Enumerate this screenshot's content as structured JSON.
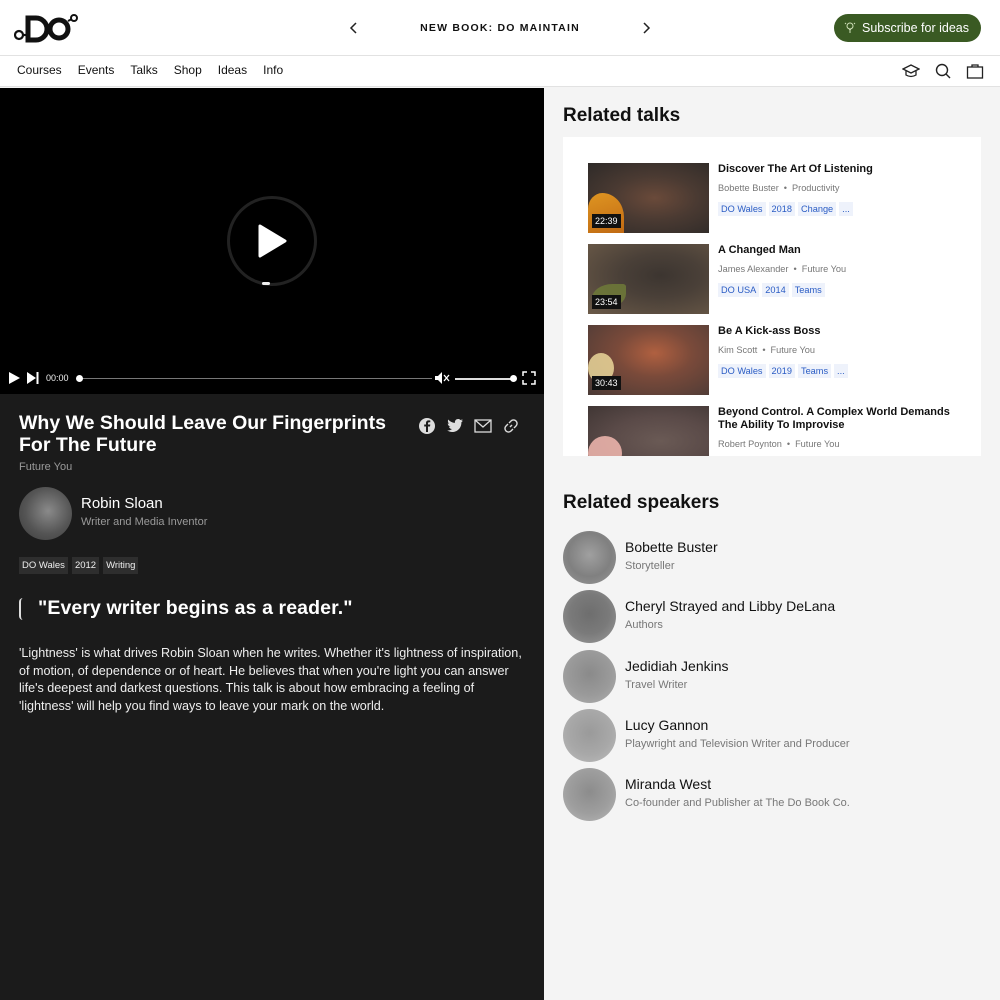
{
  "header": {
    "promo_text": "NEW BOOK: DO MAINTAIN",
    "subscribe_label": "Subscribe for ideas"
  },
  "nav": {
    "items": [
      "Courses",
      "Events",
      "Talks",
      "Shop",
      "Ideas",
      "Info"
    ]
  },
  "player": {
    "time": "00:00",
    "progress": 0,
    "volume": 1
  },
  "talk": {
    "title": "Why We Should Leave Our Fingerprints For The Future",
    "category": "Future You",
    "speaker_name": "Robin Sloan",
    "speaker_role": "Writer and Media Inventor",
    "tags": [
      "DO Wales",
      "2012",
      "Writing"
    ],
    "quote": "\"Every writer begins as a reader.\"",
    "description": "'Lightness' is what drives Robin Sloan when he writes. Whether it's lightness of inspiration, of motion, of dependence or of heart. He believes that when you're light you can answer life's deepest and darkest questions. This talk is about how embracing a feeling of 'lightness' will help you find ways to leave your mark on the world."
  },
  "related_talks": {
    "title": "Related talks",
    "items": [
      {
        "title": "Discover The Art Of Listening",
        "speaker": "Bobette Buster",
        "category": "Productivity",
        "duration": "22:39",
        "tags": [
          "DO Wales",
          "2018",
          "Change",
          "..."
        ]
      },
      {
        "title": "A Changed Man",
        "speaker": "James Alexander",
        "category": "Future You",
        "duration": "23:54",
        "tags": [
          "DO USA",
          "2014",
          "Teams"
        ]
      },
      {
        "title": "Be A Kick-ass Boss",
        "speaker": "Kim Scott",
        "category": "Future You",
        "duration": "30:43",
        "tags": [
          "DO Wales",
          "2019",
          "Teams",
          "..."
        ]
      },
      {
        "title": "Beyond Control. A Complex World Demands The Ability To Improvise",
        "speaker": "Robert Poynton",
        "category": "Future You",
        "duration": "",
        "tags": []
      }
    ]
  },
  "related_speakers": {
    "title": "Related speakers",
    "items": [
      {
        "name": "Bobette Buster",
        "role": "Storyteller"
      },
      {
        "name": "Cheryl Strayed and Libby DeLana",
        "role": "Authors"
      },
      {
        "name": "Jedidiah Jenkins",
        "role": "Travel Writer"
      },
      {
        "name": "Lucy Gannon",
        "role": "Playwright and Television Writer and Producer"
      },
      {
        "name": "Miranda West",
        "role": "Co-founder and Publisher at The Do Book Co."
      }
    ]
  },
  "colors": {
    "subscribe_bg": "#3a5a23",
    "tag_blue": "#2a5cc4",
    "dark_panel": "#1b1b1b"
  }
}
